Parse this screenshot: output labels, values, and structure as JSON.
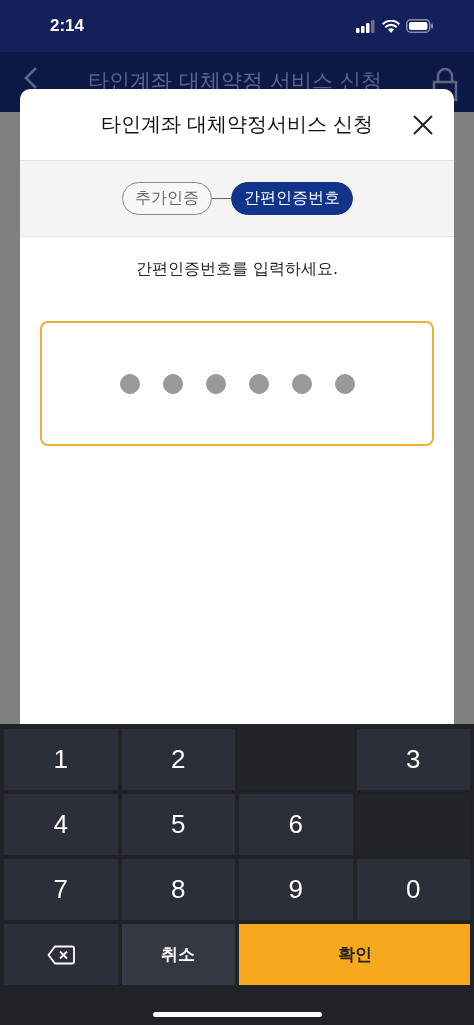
{
  "status_bar": {
    "time": "2:14"
  },
  "nav_bar": {
    "title": "타인계좌 대체약정 서비스 신청"
  },
  "dialog": {
    "title": "타인계좌 대체약정서비스 신청",
    "steps": [
      {
        "label": "추가인증",
        "selected": false
      },
      {
        "label": "간편인증번호",
        "selected": true
      }
    ],
    "instruction": "간편인증번호를 입력하세요.",
    "pin_dots": [
      {
        "filled": true
      },
      {
        "filled": true
      },
      {
        "filled": true
      },
      {
        "filled": true
      },
      {
        "filled": true
      },
      {
        "filled": true
      }
    ]
  },
  "keypad": [
    {
      "kind": "digit",
      "label": "1"
    },
    {
      "kind": "digit",
      "label": "2"
    },
    {
      "kind": "blank"
    },
    {
      "kind": "digit",
      "label": "3"
    },
    {
      "kind": "digit",
      "label": "4"
    },
    {
      "kind": "digit",
      "label": "5"
    },
    {
      "kind": "digit",
      "label": "6"
    },
    {
      "kind": "blank"
    },
    {
      "kind": "digit",
      "label": "7"
    },
    {
      "kind": "digit",
      "label": "8"
    },
    {
      "kind": "digit",
      "label": "9"
    },
    {
      "kind": "digit",
      "label": "0"
    },
    {
      "kind": "backspace"
    },
    {
      "kind": "cancel",
      "label": "취소"
    },
    {
      "kind": "confirm",
      "label": "확인"
    }
  ]
}
